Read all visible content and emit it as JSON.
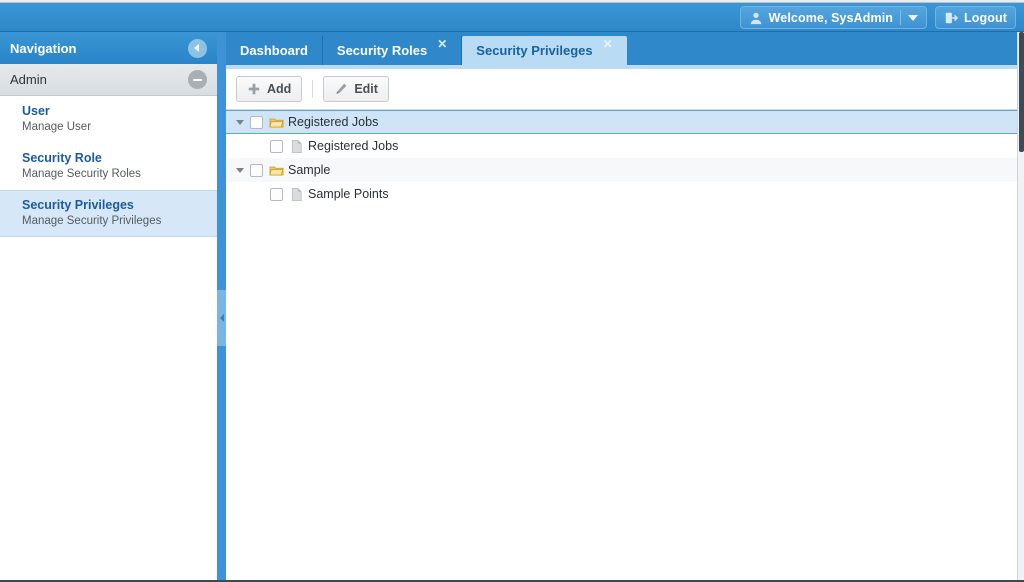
{
  "header": {
    "user_button": {
      "label": "Welcome, SysAdmin",
      "icon": "user-icon",
      "caret": "chevron-down-icon"
    },
    "logout_button": {
      "label": "Logout",
      "icon": "logout-door-icon"
    }
  },
  "sidebar": {
    "title": "Navigation",
    "collapse_icon": "chevron-left-circle-icon",
    "section": {
      "label": "Admin",
      "toggle_icon": "minus-circle-icon"
    },
    "items": [
      {
        "title": "User",
        "subtitle": "Manage User",
        "selected": false
      },
      {
        "title": "Security Role",
        "subtitle": "Manage Security Roles",
        "selected": false
      },
      {
        "title": "Security Privileges",
        "subtitle": "Manage Security Privileges",
        "selected": true
      }
    ]
  },
  "splitter": {
    "handle_icon": "chevron-left-icon"
  },
  "tabs": [
    {
      "label": "Dashboard",
      "active": false,
      "closable": false
    },
    {
      "label": "Security Roles",
      "active": false,
      "closable": true,
      "close_icon": "close-icon"
    },
    {
      "label": "Security Privileges",
      "active": true,
      "closable": true,
      "close_icon": "close-icon"
    }
  ],
  "toolbar": {
    "add_label": "Add",
    "add_icon": "plus-icon",
    "edit_label": "Edit",
    "edit_icon": "pencil-icon"
  },
  "tree": {
    "rows": [
      {
        "label": "Registered Jobs",
        "type": "folder",
        "level": 0,
        "expanded": true,
        "checked": false,
        "selected": true,
        "icon": "folder-icon"
      },
      {
        "label": "Registered Jobs",
        "type": "leaf",
        "level": 1,
        "expanded": null,
        "checked": false,
        "selected": false,
        "icon": "page-icon"
      },
      {
        "label": "Sample",
        "type": "folder",
        "level": 0,
        "expanded": true,
        "checked": false,
        "selected": false,
        "icon": "folder-icon"
      },
      {
        "label": "Sample Points",
        "type": "leaf",
        "level": 1,
        "expanded": null,
        "checked": false,
        "selected": false,
        "icon": "page-icon"
      }
    ]
  },
  "colors": {
    "header_blue": "#2e88ca",
    "active_tab": "#b9dcf4",
    "nav_selected": "#d6e8f8",
    "row_selected": "#cfe4f6",
    "link_blue": "#1d5b9e",
    "folder_yellow": "#f0c24b"
  }
}
